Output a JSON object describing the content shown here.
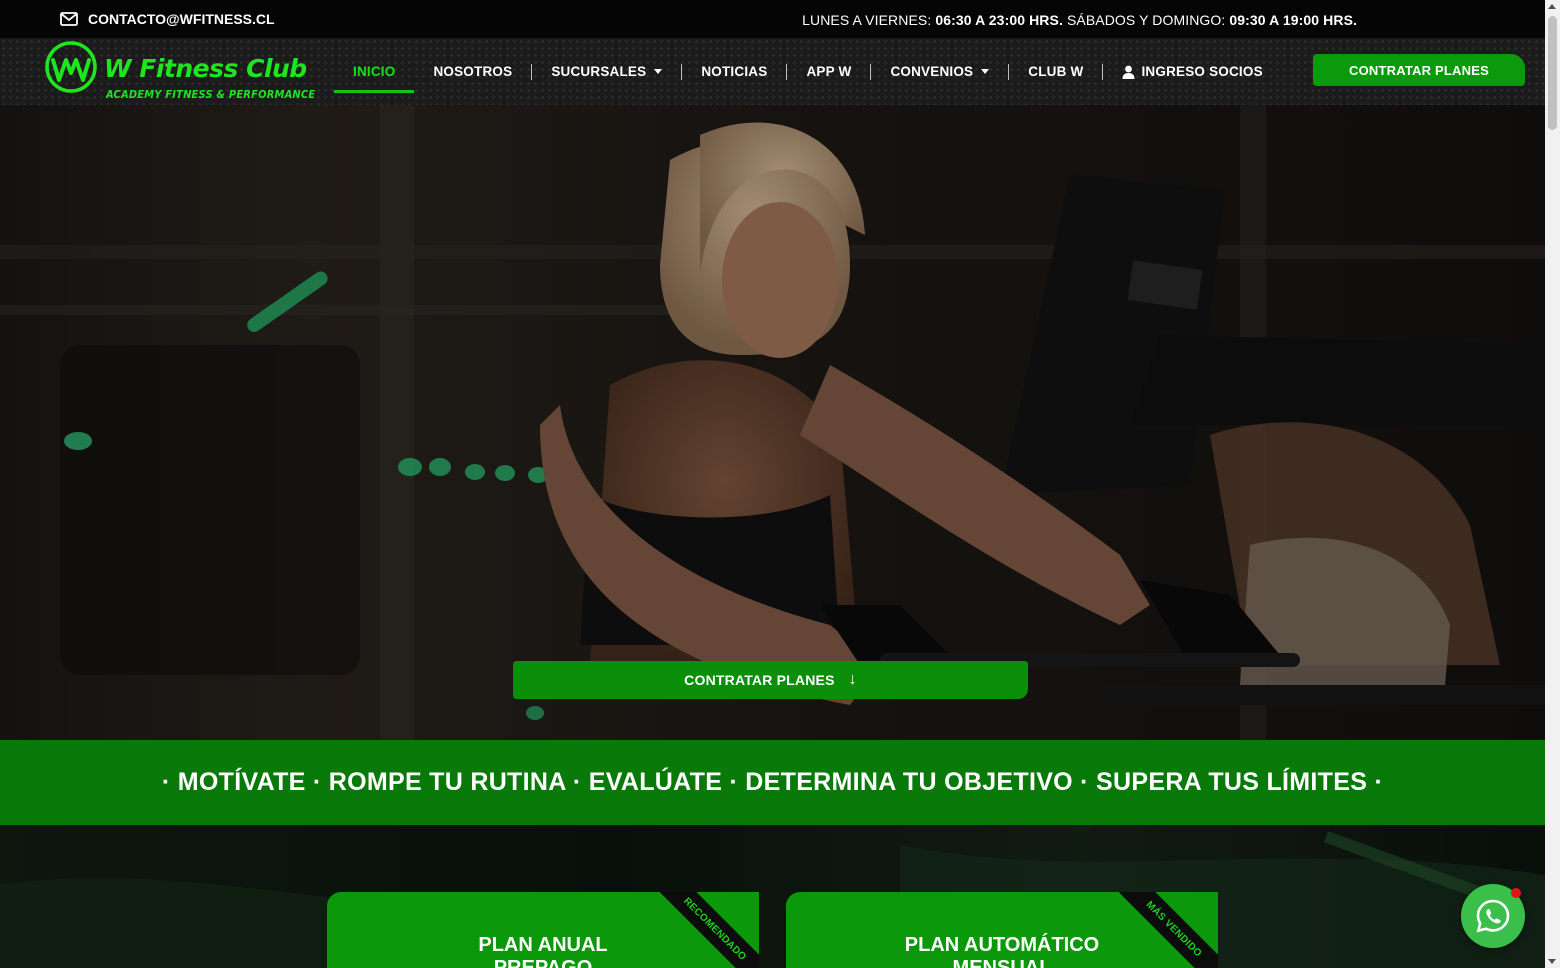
{
  "topbar": {
    "email": "CONTACTO@WFITNESS.CL",
    "hours_weekday_label": "LUNES A VIERNES:",
    "hours_weekday_value": "06:30 A 23:00 HRS.",
    "hours_weekend_label": "SÁBADOS Y DOMINGO:",
    "hours_weekend_value": "09:30 A 19:00 HRS."
  },
  "brand": {
    "name": "W Fitness Club",
    "tagline": "ACADEMY FITNESS & PERFORMANCE",
    "color": "#1ee61e"
  },
  "nav": {
    "items": [
      {
        "label": "INICIO",
        "active": true
      },
      {
        "label": "NOSOTROS"
      },
      {
        "label": "SUCURSALES",
        "dropdown": true
      },
      {
        "label": "NOTICIAS"
      },
      {
        "label": "APP W"
      },
      {
        "label": "CONVENIOS",
        "dropdown": true
      },
      {
        "label": "CLUB W"
      },
      {
        "label": "INGRESO SOCIOS",
        "icon": "user-icon"
      }
    ],
    "cta_label": "CONTRATAR PLANES"
  },
  "hero": {
    "cta_label": "CONTRATAR PLANES",
    "cta_icon": "arrow-down-icon"
  },
  "band": {
    "text": "· MOTÍVATE · ROMPE TU RUTINA · EVALÚATE · DETERMINA TU OBJETIVO · SUPERA TUS LÍMITES ·"
  },
  "plans": [
    {
      "title_line1": "PLAN ANUAL",
      "title_line2": "PREPAGO",
      "ribbon": "RECOMENDADO"
    },
    {
      "title_line1": "PLAN AUTOMÁTICO",
      "title_line2": "MENSUAL",
      "ribbon": "MÁS VENDIDO"
    }
  ],
  "colors": {
    "accent": "#0b9a0b",
    "band": "#097a09",
    "whatsapp": "#3bbf4b"
  }
}
